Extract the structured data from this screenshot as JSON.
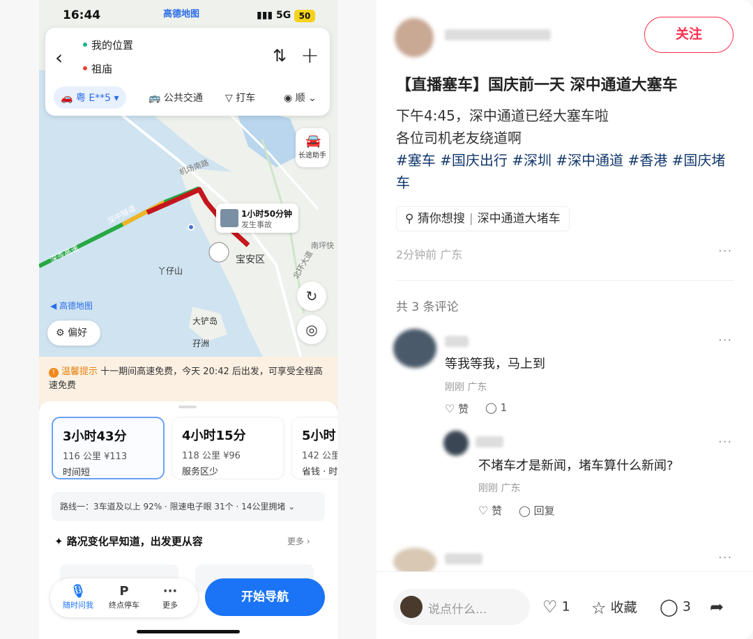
{
  "phone": {
    "status": {
      "time": "16:44",
      "app": "高德地图",
      "network": "5G",
      "battery": "50"
    },
    "route": {
      "from": "我的位置",
      "to": "祖庙"
    },
    "modes": {
      "car": "粤 E**5",
      "transit": "公共交通",
      "taxi": "打车",
      "more": "顺"
    },
    "assist_label": "长途助手",
    "traffic_tip": {
      "time": "1小时50分钟",
      "desc": "发生事故"
    },
    "map_labels": {
      "road1": "深岑高速",
      "road2": "深中隧道",
      "district": "宝安区",
      "place1": "丫仔山",
      "place2": "大铲岛",
      "place3": "孖洲",
      "road3": "机场南路",
      "road4": "南坪快",
      "road5": "北环大道",
      "logo": "高德地图"
    },
    "preference": "偏好",
    "notice": {
      "title": "温馨提示",
      "text": "十一期间高速免费，今天 20:42 后出发，可享受全程高速免费"
    },
    "options": [
      {
        "time": "3小时43分",
        "dist": "116 公里 ¥113",
        "tag": "时间短"
      },
      {
        "time": "4小时15分",
        "dist": "118 公里 ¥96",
        "tag": "服务区少"
      },
      {
        "time": "5小时",
        "dist": "142 公里",
        "tag": "省钱 · 时"
      }
    ],
    "route_info": "路线一：3车道及以上 92% · 限速电子眼 31个 · 14公里拥堵",
    "alert_title": "路况变化早知道，出发更从容",
    "more": "更多",
    "bottom": {
      "item1": "随时问我",
      "item2": "终点停车",
      "item3": "更多",
      "nav": "开始导航"
    }
  },
  "post": {
    "follow": "关注",
    "title": "【直播塞车】国庆前一天 深中通道大塞车",
    "body_line1": "下午4:45，深中通道已经大塞车啦",
    "body_line2": "各位司机老友绕道啊",
    "tags": [
      "#塞车",
      "#国庆出行",
      "#深圳",
      "#深中通道",
      "#香港",
      "#国庆堵车"
    ],
    "search_label": "猜你想搜",
    "search_term": "深中通道大堵车",
    "meta": "2分钟前  广东",
    "comment_count": "共 3 条评论",
    "comments": [
      {
        "text": "等我等我，马上到",
        "meta": "刚刚 广东",
        "like": "赞",
        "reply_count": "1"
      },
      {
        "text": "不堵车才是新闻，堵车算什么新闻?",
        "meta": "刚刚 广东",
        "like": "赞",
        "reply": "回复"
      }
    ],
    "footer": {
      "placeholder": "说点什么...",
      "likes": "1",
      "collect": "收藏",
      "comments": "3"
    }
  }
}
